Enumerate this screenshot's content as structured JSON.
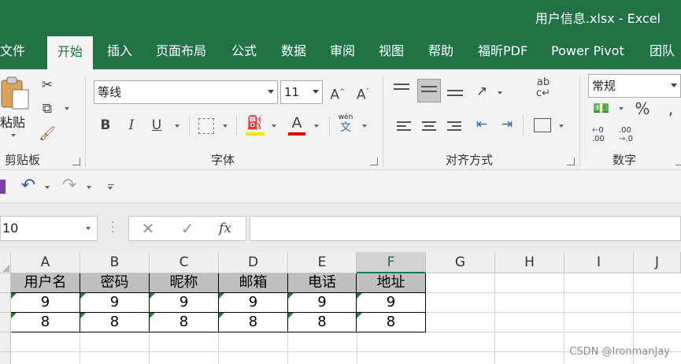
{
  "window": {
    "title": "用户信息.xlsx  -  Excel"
  },
  "tabs": [
    "文件",
    "开始",
    "插入",
    "页面布局",
    "公式",
    "数据",
    "审阅",
    "视图",
    "帮助",
    "福昕PDF",
    "Power Pivot",
    "团队"
  ],
  "ribbon": {
    "clipboard": {
      "paste_label": "粘贴",
      "group_label": "剪贴板"
    },
    "font": {
      "font_name": "等线",
      "font_size": "11",
      "bold": "B",
      "italic": "I",
      "underline": "U",
      "font_color_letter": "A",
      "phonetic_top": "wén",
      "phonetic_bottom": "文",
      "group_label": "字体",
      "fill_color": "#ffe600",
      "font_color": "#e00000"
    },
    "alignment": {
      "group_label": "对齐方式"
    },
    "number": {
      "format": "常规",
      "percent": "%",
      "inc_decimal": ".00",
      "dec_decimal": ".0",
      "group_label": "数字"
    }
  },
  "formula_bar": {
    "name_box": "10",
    "fx_label": "fx",
    "formula": ""
  },
  "sheet": {
    "columns": [
      "A",
      "B",
      "C",
      "D",
      "E",
      "F",
      "G",
      "H",
      "I",
      "J"
    ],
    "selected_column": "F",
    "header_row": [
      "用户名",
      "密码",
      "昵称",
      "邮箱",
      "电话",
      "地址"
    ],
    "rows": [
      [
        "9",
        "9",
        "9",
        "9",
        "9",
        "9"
      ],
      [
        "8",
        "8",
        "8",
        "8",
        "8",
        "8"
      ]
    ]
  },
  "watermark": "CSDN @IronmanJay",
  "colors": {
    "accent": "#217346",
    "header_fill": "#bfbfbf"
  }
}
